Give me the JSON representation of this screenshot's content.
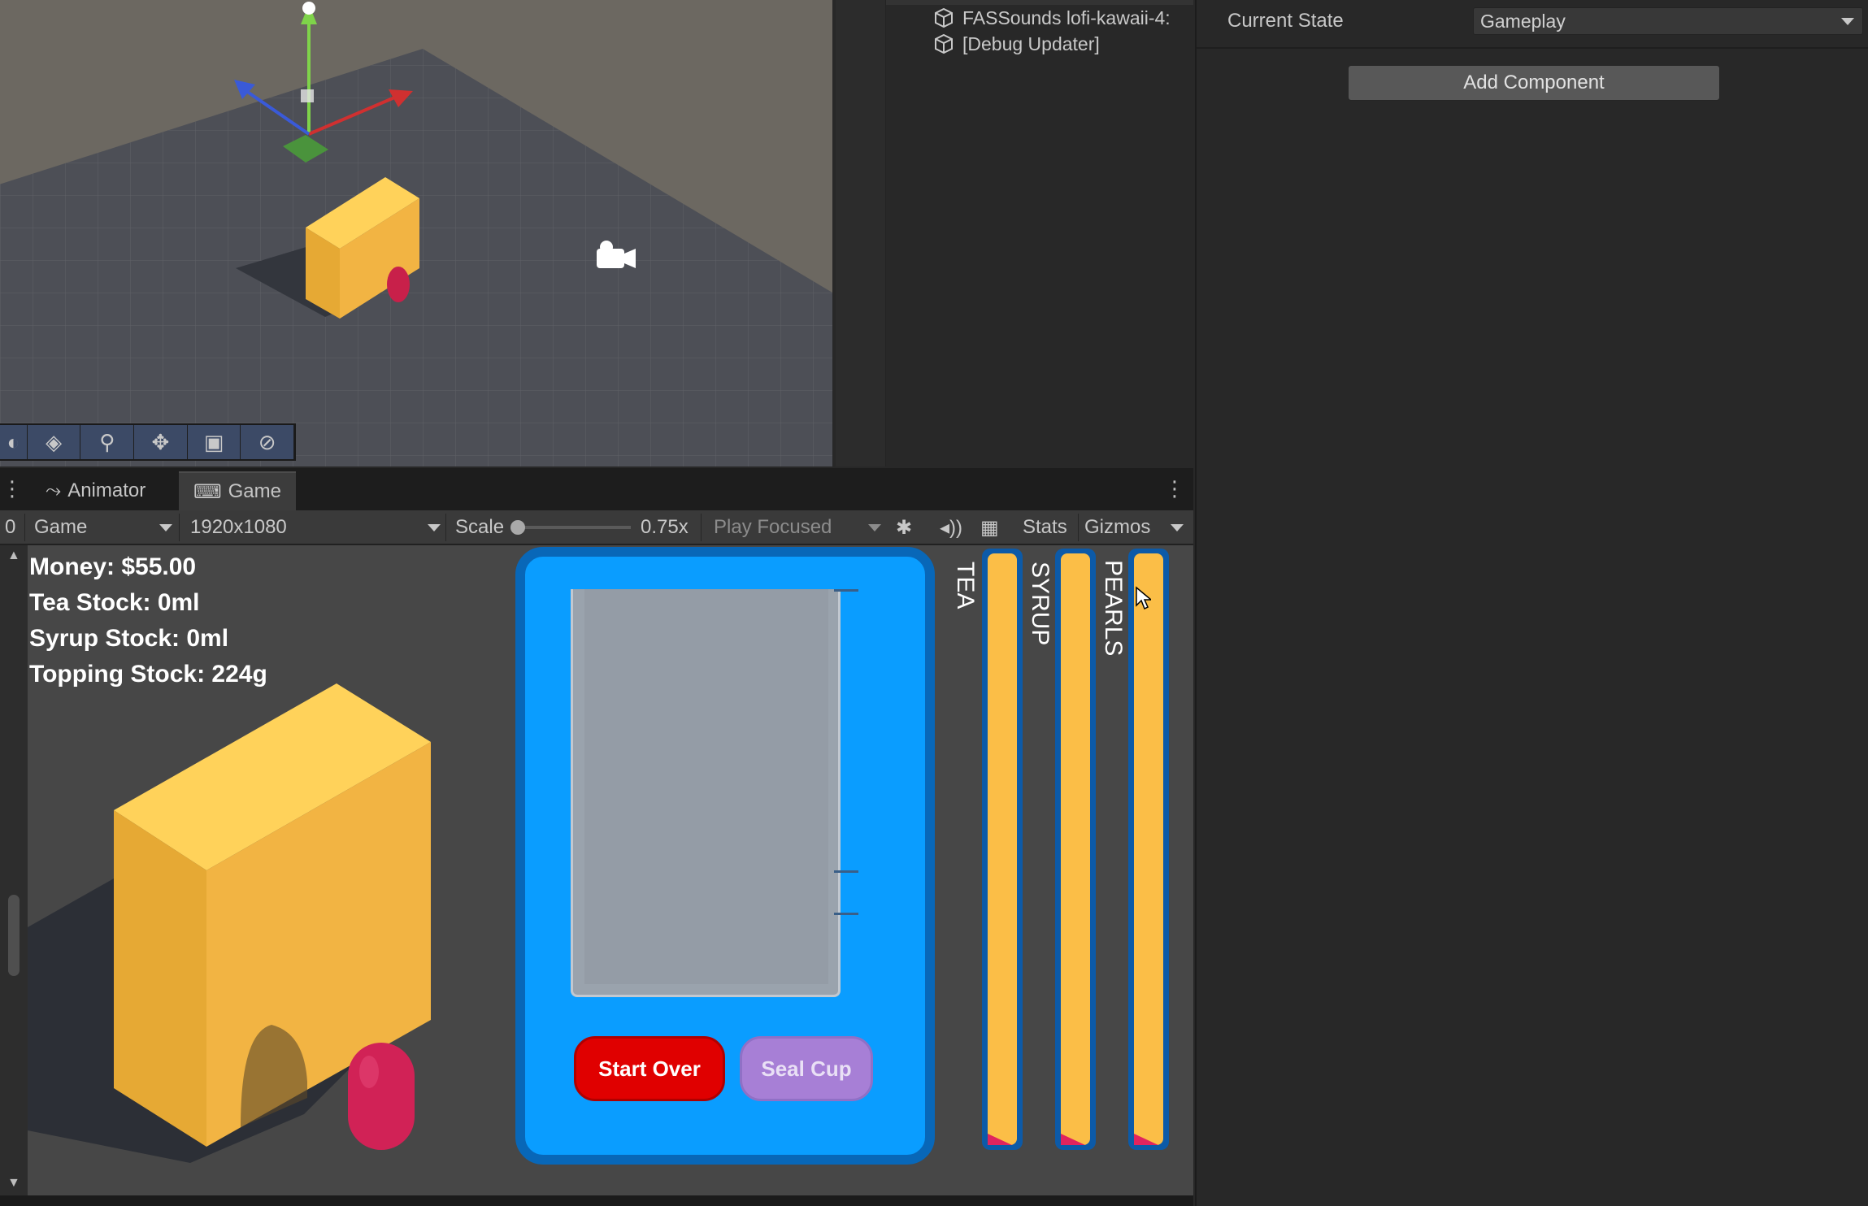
{
  "hierarchy": {
    "items": [
      "FASSounds lofi-kawaii-4:",
      "[Debug Updater]"
    ]
  },
  "inspector": {
    "current_state_label": "Current State",
    "current_state_value": "Gameplay",
    "add_component_label": "Add Component"
  },
  "tabs": {
    "animator": "Animator",
    "game": "Game"
  },
  "game_toolbar": {
    "display": "0",
    "mode": "Game",
    "resolution": "1920x1080",
    "scale_label": "Scale",
    "scale_value": "0.75x",
    "scale_fraction": 0,
    "play_mode": "Play Focused",
    "stats": "Stats",
    "gizmos": "Gizmos"
  },
  "hud": {
    "money": "Money: $55.00",
    "tea_stock": "Tea Stock: 0ml",
    "syrup_stock": "Syrup Stock: 0ml",
    "topping_stock": "Topping Stock: 224g"
  },
  "cup_panel": {
    "start_over": "Start Over",
    "seal_cup": "Seal Cup"
  },
  "gauges": [
    {
      "label": "TEA",
      "level": 1.0
    },
    {
      "label": "SYRUP",
      "level": 1.0
    },
    {
      "label": "PEARLS",
      "level": 1.0
    }
  ],
  "colors": {
    "panel_blue": "#0a9dff",
    "gauge_fill": "#fbbe47",
    "start_red": "#e00000",
    "seal_purple": "#a77fd6",
    "box_yellow": "#f2b443"
  }
}
